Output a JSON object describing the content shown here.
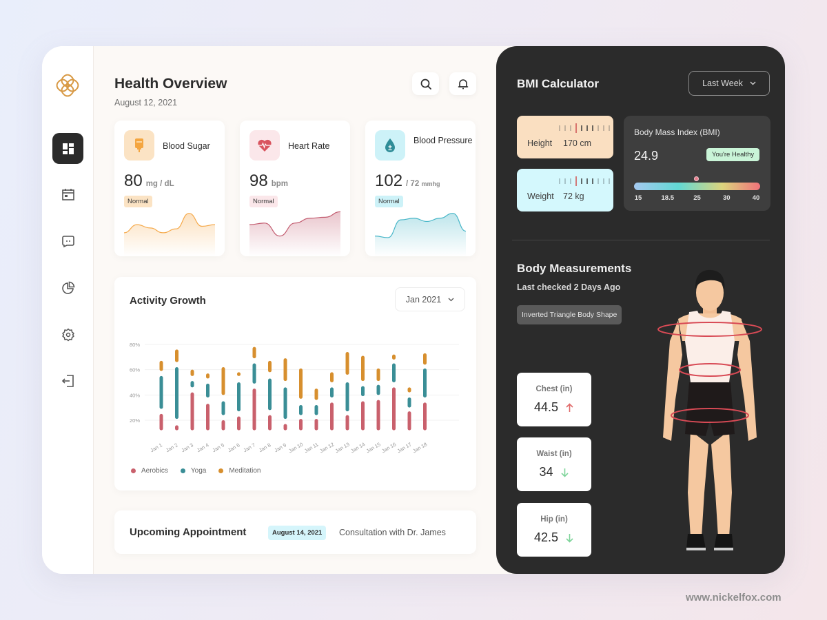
{
  "sidebar": {
    "logo": "brand-logo-icon",
    "items": [
      {
        "name": "dashboard",
        "icon": "grid-icon",
        "active": true
      },
      {
        "name": "calendar",
        "icon": "calendar-icon",
        "active": false
      },
      {
        "name": "messages",
        "icon": "chat-icon",
        "active": false
      },
      {
        "name": "reports",
        "icon": "pie-chart-icon",
        "active": false
      },
      {
        "name": "settings",
        "icon": "gear-icon",
        "active": false
      },
      {
        "name": "logout",
        "icon": "logout-icon",
        "active": false
      }
    ]
  },
  "header": {
    "title": "Health Overview",
    "date": "August 12, 2021",
    "search_icon": "search-icon",
    "notification_icon": "bell-icon"
  },
  "metrics": [
    {
      "name": "Blood Sugar",
      "value": "80",
      "unit": "mg / dL",
      "unit_small": "",
      "status": "Normal",
      "accent": "#f5a94a",
      "icon_bg": "#fbe3c4",
      "badge_bg": "#fbe3c4",
      "icon": "iv-bag-icon",
      "trend": [
        0.3,
        0.55,
        0.45,
        0.3,
        0.42,
        0.9,
        0.5,
        0.55
      ]
    },
    {
      "name": "Heart Rate",
      "value": "98",
      "unit": "bpm",
      "unit_small": "",
      "status": "Normal",
      "accent": "#c25a6e",
      "icon_bg": "#fbe7ea",
      "badge_bg": "#fbe7ea",
      "icon": "heart-pulse-icon",
      "trend": [
        0.55,
        0.6,
        0.2,
        0.6,
        0.75,
        0.78,
        0.95
      ]
    },
    {
      "name": "Blood Pressure",
      "value": "102",
      "unit": "/ 72",
      "unit_small": "mmhg",
      "status": "Normal",
      "accent": "#45b5c7",
      "icon_bg": "#cdf2f8",
      "badge_bg": "#cdf2f8",
      "icon": "blood-drop-icon",
      "trend": [
        0.2,
        0.15,
        0.7,
        0.75,
        0.65,
        0.75,
        0.9,
        0.35
      ]
    }
  ],
  "activity": {
    "title": "Activity Growth",
    "period": "Jan 2021",
    "legend": [
      {
        "label": "Aerobics",
        "color": "#c9606c"
      },
      {
        "label": "Yoga",
        "color": "#3a8e96"
      },
      {
        "label": "Meditation",
        "color": "#d78f2e"
      }
    ]
  },
  "chart_data": {
    "type": "bar",
    "subtype": "floating-range-stacked",
    "title": "Activity Growth",
    "xlabel": "",
    "ylabel": "",
    "ylim": [
      10,
      85
    ],
    "yticks": [
      "20%",
      "40%",
      "60%",
      "80%"
    ],
    "ytick_values": [
      20,
      40,
      60,
      80
    ],
    "grid": true,
    "legend_position": "bottom-left",
    "categories": [
      "Jan 1",
      "Jan 2",
      "Jan 3",
      "Jan 4",
      "Jan 5",
      "Jan 6",
      "Jan 7",
      "Jan 8",
      "Jan 9",
      "Jan 10",
      "Jan 11",
      "Jan 12",
      "Jan 13",
      "Jan 14",
      "Jan 15",
      "Jan 16",
      "Jan 17",
      "Jan 18"
    ],
    "series": [
      {
        "name": "Aerobics",
        "color": "#c9606c",
        "ranges": [
          [
            12,
            25
          ],
          [
            12,
            16
          ],
          [
            12,
            42
          ],
          [
            12,
            33
          ],
          [
            12,
            20
          ],
          [
            12,
            23
          ],
          [
            12,
            45
          ],
          [
            12,
            24
          ],
          [
            12,
            17
          ],
          [
            12,
            21
          ],
          [
            12,
            21
          ],
          [
            12,
            34
          ],
          [
            12,
            24
          ],
          [
            12,
            35
          ],
          [
            12,
            36
          ],
          [
            12,
            46
          ],
          [
            12,
            27
          ],
          [
            12,
            34
          ]
        ]
      },
      {
        "name": "Yoga",
        "color": "#3a8e96",
        "ranges": [
          [
            29,
            55
          ],
          [
            21,
            62
          ],
          [
            46,
            51
          ],
          [
            38,
            49
          ],
          [
            24,
            35
          ],
          [
            27,
            50
          ],
          [
            49,
            65
          ],
          [
            28,
            53
          ],
          [
            21,
            46
          ],
          [
            24,
            32
          ],
          [
            24,
            32
          ],
          [
            38,
            46
          ],
          [
            27,
            50
          ],
          [
            39,
            47
          ],
          [
            40,
            48
          ],
          [
            50,
            65
          ],
          [
            30,
            38
          ],
          [
            38,
            61
          ]
        ]
      },
      {
        "name": "Meditation",
        "color": "#d78f2e",
        "ranges": [
          [
            59,
            67
          ],
          [
            66,
            76
          ],
          [
            55,
            60
          ],
          [
            53,
            57
          ],
          [
            40,
            62
          ],
          [
            55,
            58
          ],
          [
            69,
            78
          ],
          [
            58,
            67
          ],
          [
            51,
            69
          ],
          [
            37,
            61
          ],
          [
            36,
            45
          ],
          [
            50,
            58
          ],
          [
            56,
            74
          ],
          [
            51,
            71
          ],
          [
            51,
            61
          ],
          [
            68,
            72
          ],
          [
            42,
            46
          ],
          [
            64,
            73
          ]
        ]
      }
    ]
  },
  "appointment": {
    "title": "Upcoming Appointment",
    "date": "August 14, 2021",
    "description": "Consultation with Dr. James"
  },
  "bmi": {
    "title": "BMI Calculator",
    "period": "Last Week",
    "height_label": "Height",
    "height_value": "170 cm",
    "weight_label": "Weight",
    "weight_value": "72 kg",
    "index_label": "Body Mass Index (BMI)",
    "index_value": "24.9",
    "index_numeric": 24.9,
    "status": "You're Healthy",
    "scale_labels": [
      "15",
      "18.5",
      "25",
      "30",
      "40"
    ],
    "scale_values": [
      15,
      18.5,
      25,
      30,
      40
    ]
  },
  "body": {
    "title": "Body Measurements",
    "subtitle": "Last checked 2 Days Ago",
    "shape": "Inverted Triangle Body Shape",
    "measurements": [
      {
        "label": "Chest (in)",
        "value": "44.5",
        "trend": "up",
        "trend_color": "#e06a6a"
      },
      {
        "label": "Waist (in)",
        "value": "34",
        "trend": "down",
        "trend_color": "#7ed49a"
      },
      {
        "label": "Hip (in)",
        "value": "42.5",
        "trend": "down",
        "trend_color": "#7ed49a"
      }
    ]
  },
  "watermark": "www.nickelfox.com"
}
